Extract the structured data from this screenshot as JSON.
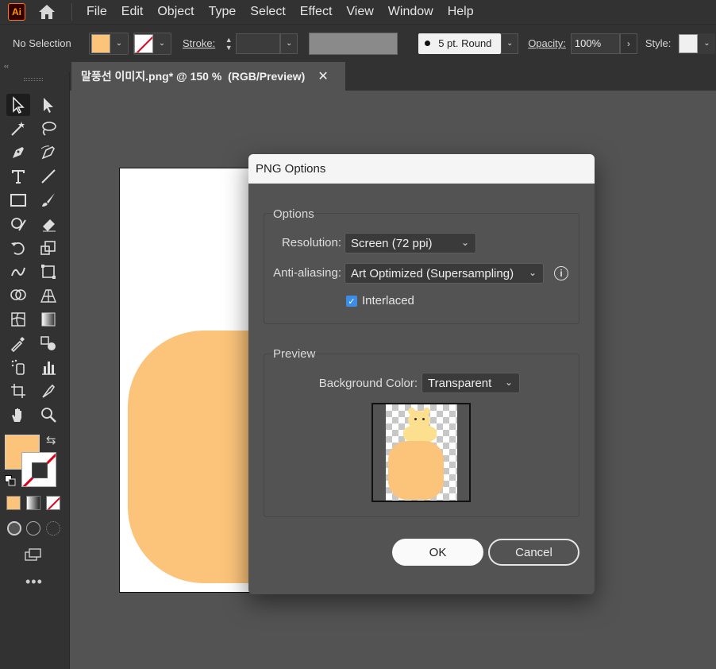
{
  "app": {
    "logo": "Ai",
    "menu": [
      "File",
      "Edit",
      "Object",
      "Type",
      "Select",
      "Effect",
      "View",
      "Window",
      "Help"
    ]
  },
  "control_bar": {
    "selection_status": "No Selection",
    "stroke_label": "Stroke:",
    "brush": "5 pt. Round",
    "opacity_label": "Opacity:",
    "opacity_value": "100%",
    "style_label": "Style:",
    "fill_color": "#fbc47a"
  },
  "document": {
    "tab_title": "말풍선 이미지.png* @ 150 %  (RGB/Preview)",
    "close_glyph": "✕"
  },
  "toolbar": {
    "collapse_glyph": "‹‹",
    "more_glyph": "•••",
    "fill_color": "#fbc47a"
  },
  "dialog": {
    "title": "PNG Options",
    "options_group": {
      "legend": "Options",
      "resolution_label": "Resolution:",
      "resolution_value": "Screen (72 ppi)",
      "antialias_label": "Anti-aliasing:",
      "antialias_value": "Art Optimized (Supersampling)",
      "interlaced_label": "Interlaced",
      "interlaced_checked": true
    },
    "preview_group": {
      "legend": "Preview",
      "background_label": "Background Color:",
      "background_value": "Transparent"
    },
    "ok_label": "OK",
    "cancel_label": "Cancel"
  }
}
